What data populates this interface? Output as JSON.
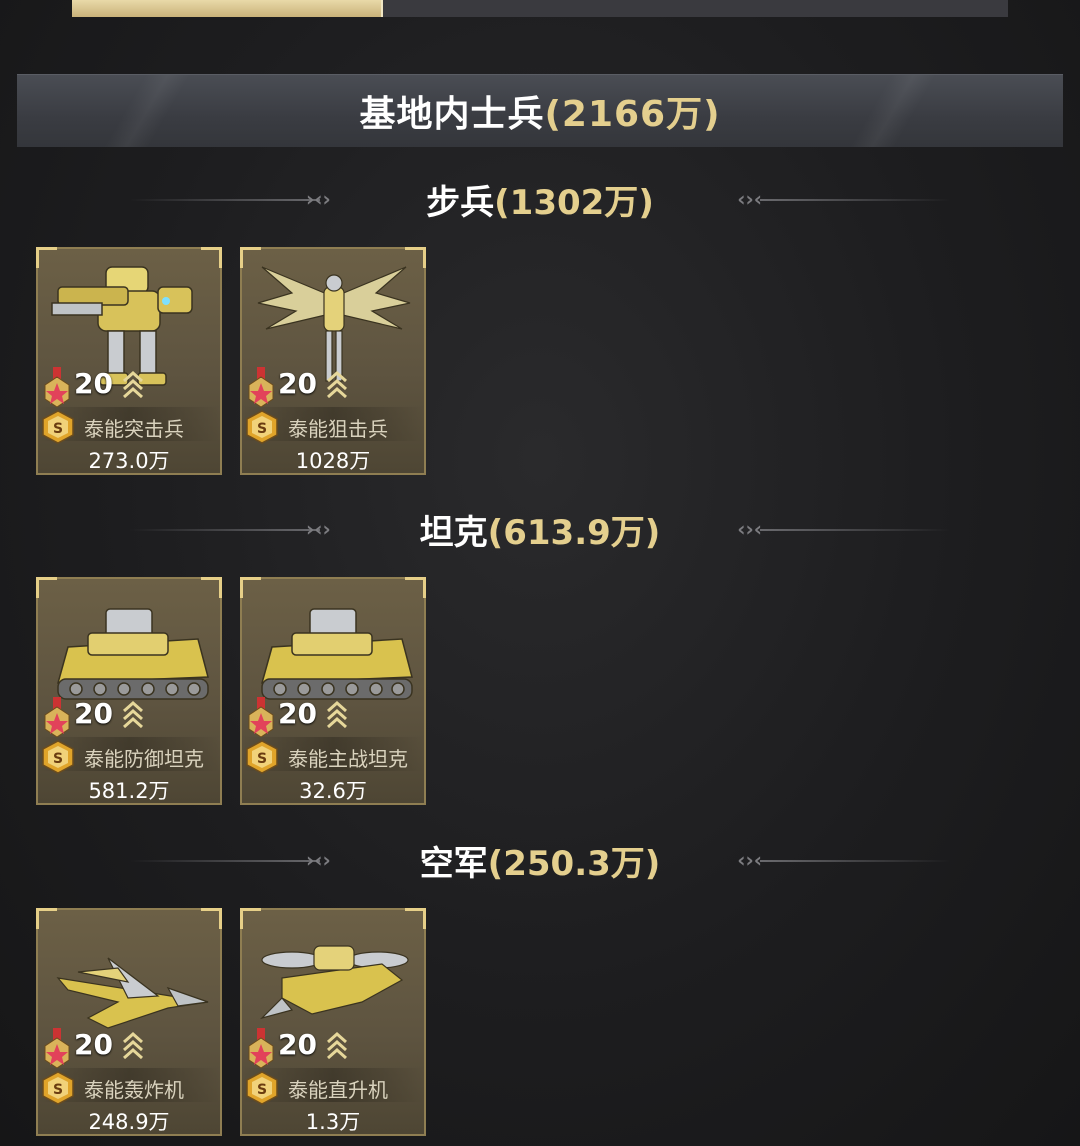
{
  "progress": {
    "fill_percent": 33
  },
  "header": {
    "name": "基地内士兵",
    "open": "(",
    "value": "2166万",
    "close": ")"
  },
  "sections": [
    {
      "name": "步兵",
      "open": "(",
      "value": "1302万",
      "close": ")",
      "units": [
        {
          "level": "20",
          "name": "泰能突击兵",
          "power": "273.0万",
          "icon": "mech-infantry"
        },
        {
          "level": "20",
          "name": "泰能狙击兵",
          "power": "1028万",
          "icon": "winged-mech"
        }
      ]
    },
    {
      "name": "坦克",
      "open": "(",
      "value": "613.9万",
      "close": ")",
      "units": [
        {
          "level": "20",
          "name": "泰能防御坦克",
          "power": "581.2万",
          "icon": "tank"
        },
        {
          "level": "20",
          "name": "泰能主战坦克",
          "power": "32.6万",
          "icon": "tank"
        }
      ]
    },
    {
      "name": "空军",
      "open": "(",
      "value": "250.3万",
      "close": ")",
      "units": [
        {
          "level": "20",
          "name": "泰能轰炸机",
          "power": "248.9万",
          "icon": "jet"
        },
        {
          "level": "20",
          "name": "泰能直升机",
          "power": "1.3万",
          "icon": "helicopter"
        }
      ]
    }
  ],
  "colors": {
    "accent_gold": "#e4cf8e",
    "card_bg": "#5e5440",
    "card_border": "#8f7e52"
  }
}
